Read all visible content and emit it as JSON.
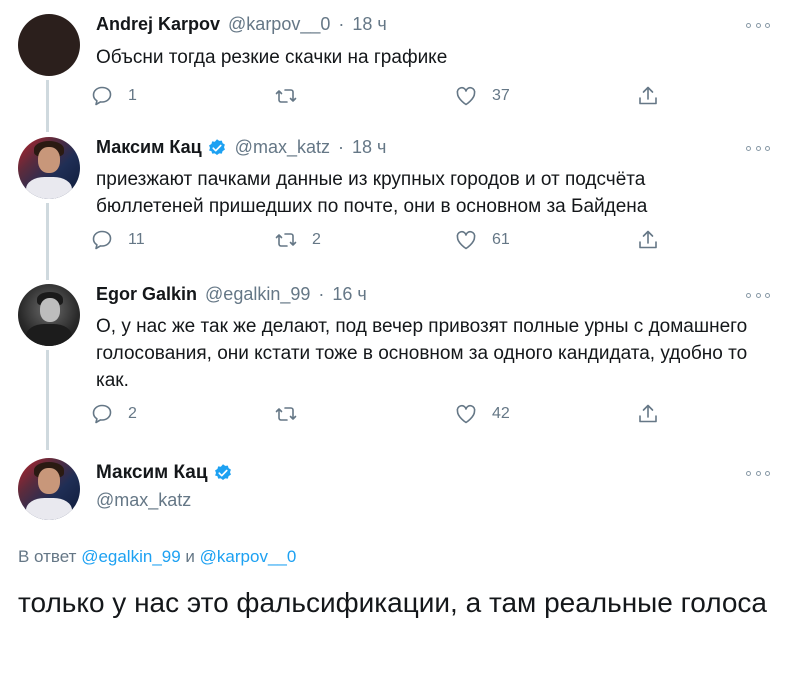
{
  "colors": {
    "accent": "#1da1f2",
    "muted": "#657786",
    "thread_line": "#cfd9de",
    "verified": "#1da1f2"
  },
  "tweets": [
    {
      "name": "Andrej Karpov",
      "handle": "@karpov__0",
      "dot": "·",
      "time": "18 ч",
      "verified": false,
      "text": "Объсни тогда резкие скачки на графике",
      "replies": "1",
      "retweets": "",
      "likes": "37"
    },
    {
      "name": "Максим Кац",
      "handle": "@max_katz",
      "dot": "·",
      "time": "18 ч",
      "verified": true,
      "text": "приезжают пачками данные из крупных городов и от подсчёта бюллетеней пришедших по почте, они в основном за Байдена",
      "replies": "11",
      "retweets": "2",
      "likes": "61"
    },
    {
      "name": "Egor Galkin",
      "handle": "@egalkin_99",
      "dot": "·",
      "time": "16 ч",
      "verified": false,
      "text": "О, у нас же так же делают, под вечер привозят полные урны с домашнего голосования, они кстати тоже в основном за одного кандидата, удобно то как.",
      "replies": "2",
      "retweets": "",
      "likes": "42"
    }
  ],
  "main_tweet": {
    "name": "Максим Кац",
    "handle": "@max_katz",
    "reply_prefix": "В ответ",
    "reply_mention_1": "@egalkin_99",
    "reply_conj": "и",
    "reply_mention_2": "@karpov__0",
    "text": "только у нас это фальсификации, а там реальные голоса"
  },
  "icons": {
    "reply": "reply-icon",
    "retweet": "retweet-icon",
    "like": "heart-icon",
    "share": "share-icon",
    "more": "more-icon",
    "verified": "verified-badge-icon"
  }
}
